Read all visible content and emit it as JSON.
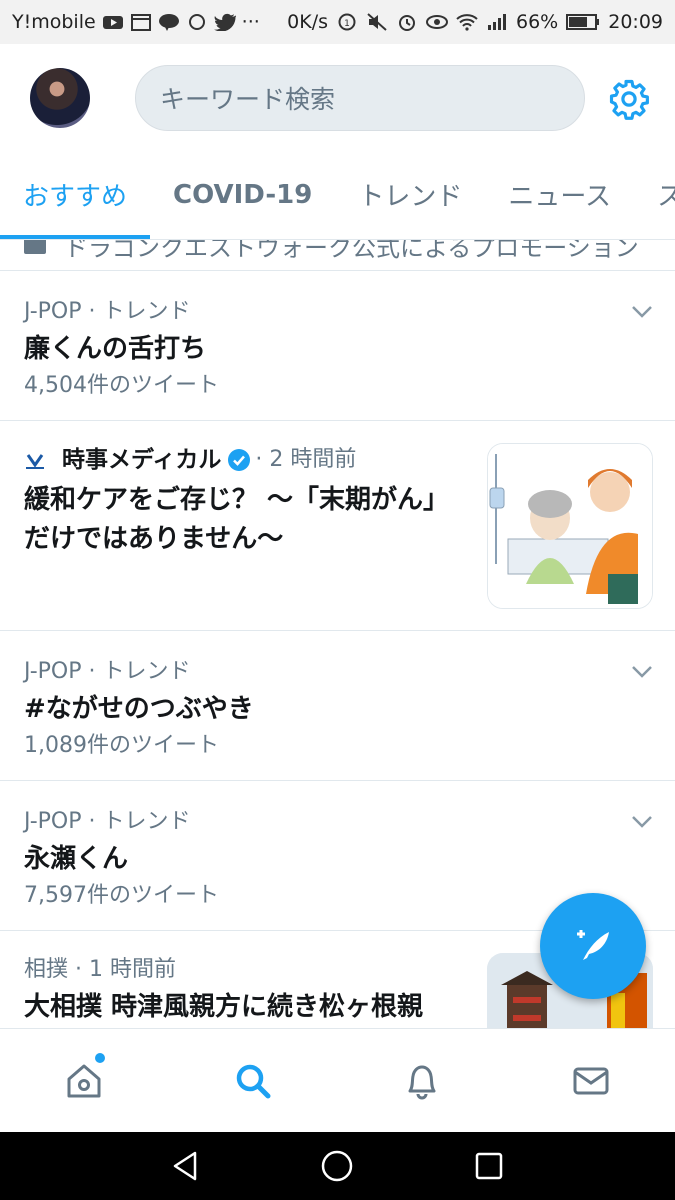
{
  "status_bar": {
    "carrier": "Y!mobile",
    "speed": "0K/s",
    "battery": "66%",
    "time": "20:09"
  },
  "search": {
    "placeholder": "キーワード検索"
  },
  "tabs": [
    {
      "label": "おすすめ",
      "active": true
    },
    {
      "label": "COVID-19",
      "active": false
    },
    {
      "label": "トレンド",
      "active": false
    },
    {
      "label": "ニュース",
      "active": false
    },
    {
      "label": "ス",
      "active": false
    }
  ],
  "promo": {
    "text": "ドラゴンクエストウォーク公式によるプロモーション"
  },
  "trends": [
    {
      "meta": "J-POP · トレンド",
      "title": "廉くんの舌打ち",
      "count": "4,504件のツイート"
    },
    {
      "meta": "J-POP · トレンド",
      "title": "#ながせのつぶやき",
      "count": "1,089件のツイート"
    },
    {
      "meta": "J-POP · トレンド",
      "title": "永瀬くん",
      "count": "7,597件のツイート"
    }
  ],
  "news": {
    "source": "時事メディカル",
    "time": "· 2 時間前",
    "headline": "緩和ケアをご存じ？ ～「末期がん」だけではありません～"
  },
  "news2": {
    "meta": "相撲 · 1 時間前",
    "headline": "大相撲 時津風親方に続き松ヶ根親"
  },
  "colors": {
    "accent": "#1da1f2",
    "secondary_text": "#657786",
    "primary_text": "#14171a",
    "divider": "#e1e8ed"
  },
  "icons": {
    "settings": "gear-icon",
    "compose": "compose-tweet-icon",
    "home": "home-icon",
    "search": "search-icon",
    "notifications": "bell-icon",
    "messages": "mail-icon"
  }
}
